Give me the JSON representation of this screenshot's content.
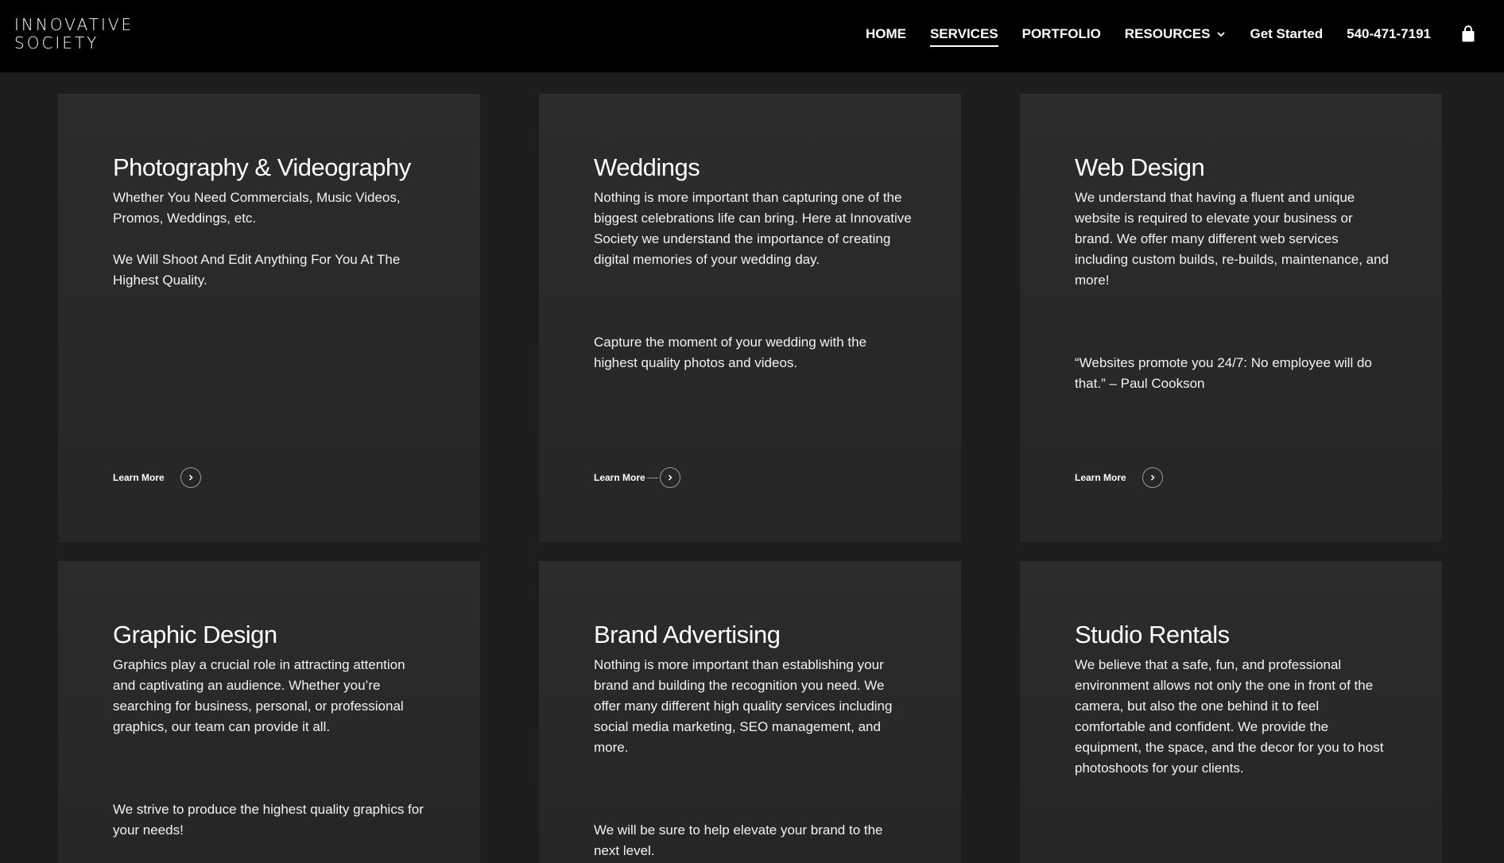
{
  "logo": {
    "line1": "INNOVATIVE",
    "line2": "SOCIETY"
  },
  "nav": {
    "home": "HOME",
    "services": "SERVICES",
    "portfolio": "PORTFOLIO",
    "resources": "RESOURCES",
    "get_started": "Get Started",
    "phone": "540-471-7191"
  },
  "cards": [
    {
      "title": "Photography & Videography",
      "p1": "Whether You Need Commercials, Music Videos, Promos, Weddings, etc.",
      "p2": "We Will Shoot And Edit Anything For You At The Highest Quality.",
      "cta": "Learn More"
    },
    {
      "title": "Weddings",
      "p1": "Nothing is more important than capturing one of the biggest celebrations life can bring. Here at Innovative Society we understand the importance of creating digital memories of your wedding day.",
      "p2": "Capture the moment of your wedding with the highest quality photos and videos.",
      "cta": "Learn More"
    },
    {
      "title": "Web Design",
      "p1": "We understand that having a fluent and unique website is required to elevate your business or brand. We offer many different web services including custom builds, re-builds, maintenance, and more!",
      "p2": "“Websites promote you 24/7: No employee will do that.” – Paul Cookson",
      "cta": "Learn More"
    },
    {
      "title": "Graphic Design",
      "p1": "Graphics play a crucial role in attracting attention and captivating an audience. Whether you’re searching for business, personal, or professional graphics, our team can provide it all.",
      "p2": "We strive to produce the highest quality graphics for your needs!"
    },
    {
      "title": "Brand Advertising",
      "p1": "Nothing is more important than establishing your brand and building the recognition you need. We offer many different high quality services including social media marketing, SEO management, and more.",
      "p2": "We will be sure to help elevate your brand to the next level."
    },
    {
      "title": "Studio Rentals",
      "p1": "We believe that a safe, fun, and professional environment allows not only the one in front of the camera, but also the one behind it to feel comfortable and confident. We provide the equipment, the space, and the decor for you to host photoshoots for your clients."
    }
  ],
  "colors": {
    "header_bg": "#000000",
    "page_bg": "#1d1d1d",
    "card_bg": "#2a2a2a",
    "text": "#ffffff"
  },
  "icons": {
    "cart": "shopping-bag-icon",
    "chevron": "chevron-down-icon",
    "arrow": "arrow-right-circle-icon"
  }
}
